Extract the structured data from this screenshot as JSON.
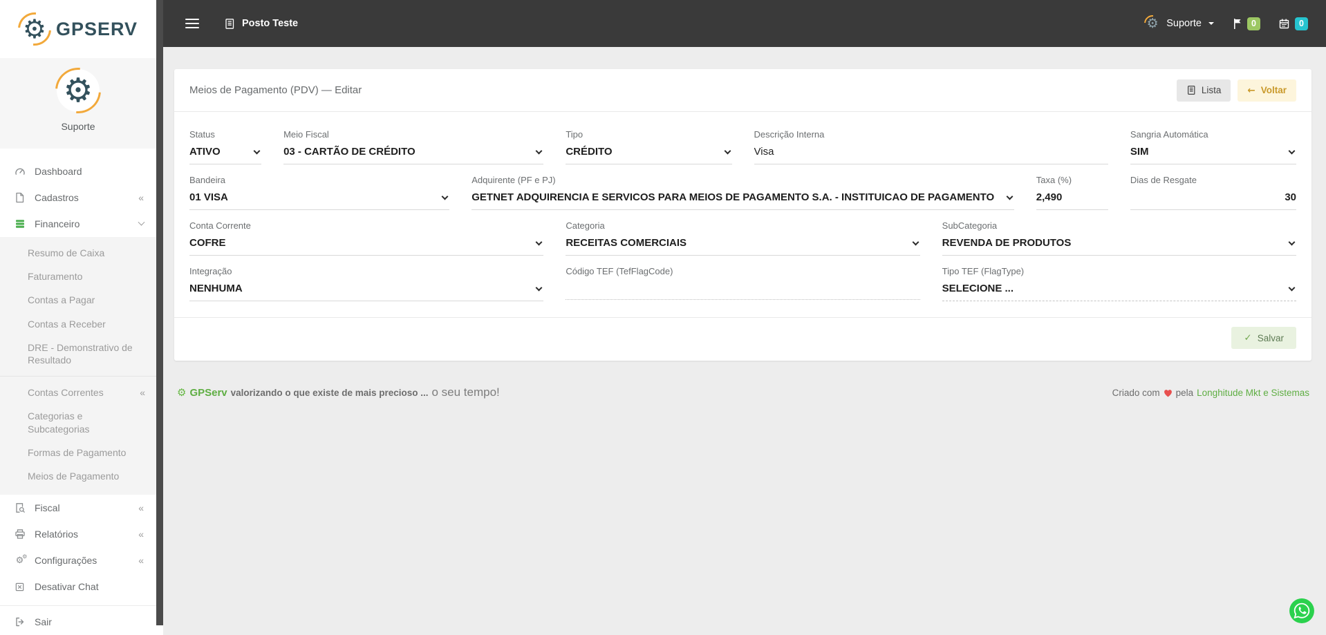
{
  "navbar": {
    "company": "Posto Teste",
    "user_name": "Suporte",
    "flag_count": "0",
    "agenda_count": "0"
  },
  "sidebar": {
    "brand": "GPSERV",
    "profile_name": "Suporte",
    "collapse_glyph": "«",
    "menu": [
      {
        "label": "Dashboard"
      },
      {
        "label": "Cadastros"
      },
      {
        "label": "Financeiro"
      },
      {
        "label": "Fiscal"
      },
      {
        "label": "Relatórios"
      },
      {
        "label": "Configurações"
      },
      {
        "label": "Desativar Chat"
      },
      {
        "label": "Sair"
      }
    ],
    "submenu": [
      "Resumo de Caixa",
      "Faturamento",
      "Contas a Pagar",
      "Contas a Receber",
      "DRE - Demonstrativo de Resultado",
      "Contas Correntes",
      "Categorias e Subcategorias",
      "Formas de Pagamento",
      "Meios de Pagamento"
    ]
  },
  "main": {
    "title": "Meios de Pagamento (PDV) — Editar",
    "buttons": {
      "lista": "Lista",
      "voltar": "Voltar",
      "salvar": "Salvar"
    },
    "fields": {
      "status": {
        "label": "Status",
        "value": "ATIVO"
      },
      "meio_fiscal": {
        "label": "Meio Fiscal",
        "value": "03 - CARTÃO DE CRÉDITO"
      },
      "tipo": {
        "label": "Tipo",
        "value": "CRÉDITO"
      },
      "descricao": {
        "label": "Descrição Interna",
        "value": "Visa"
      },
      "sangria": {
        "label": "Sangria Automática",
        "value": "SIM"
      },
      "bandeira": {
        "label": "Bandeira",
        "value": "01 VISA"
      },
      "adquirente": {
        "label": "Adquirente (PF e PJ)",
        "value": "GETNET ADQUIRENCIA E SERVICOS PARA MEIOS DE PAGAMENTO S.A. - INSTITUICAO DE PAGAMENTO"
      },
      "taxa": {
        "label": "Taxa (%)",
        "value": "2,490"
      },
      "dias_resgate": {
        "label": "Dias de Resgate",
        "value": "30"
      },
      "conta": {
        "label": "Conta Corrente",
        "value": "COFRE"
      },
      "categoria": {
        "label": "Categoria",
        "value": "RECEITAS COMERCIAIS"
      },
      "subcategoria": {
        "label": "SubCategoria",
        "value": "REVENDA DE PRODUTOS"
      },
      "integracao": {
        "label": "Integração",
        "value": "NENHUMA"
      },
      "codigo_tef": {
        "label": "Código TEF (TefFlagCode)",
        "value": ""
      },
      "tipo_tef": {
        "label": "Tipo TEF (FlagType)",
        "value": "SELECIONE ..."
      }
    }
  },
  "footer": {
    "brand": "GPServ",
    "tagline": "valorizando o que existe de mais precioso ...",
    "tagline_em": "o seu tempo!",
    "credit_prefix": "Criado com",
    "credit_middle": "pela",
    "credit_link": "Longhitude Mkt e Sistemas"
  },
  "icons": {
    "gear": "⚙",
    "check": "✓",
    "arrow_left": "←"
  },
  "colors": {
    "navbar_bg": "#3a3a3a",
    "badge_green": "#9cc763",
    "badge_teal": "#26c4cf",
    "accent_green": "#5fae43",
    "financeiro_icon_green": "#4caf50",
    "voltar_text": "#c9992a",
    "salvar_bg": "#e9f2e0",
    "whatsapp_green": "#2bd14d"
  }
}
